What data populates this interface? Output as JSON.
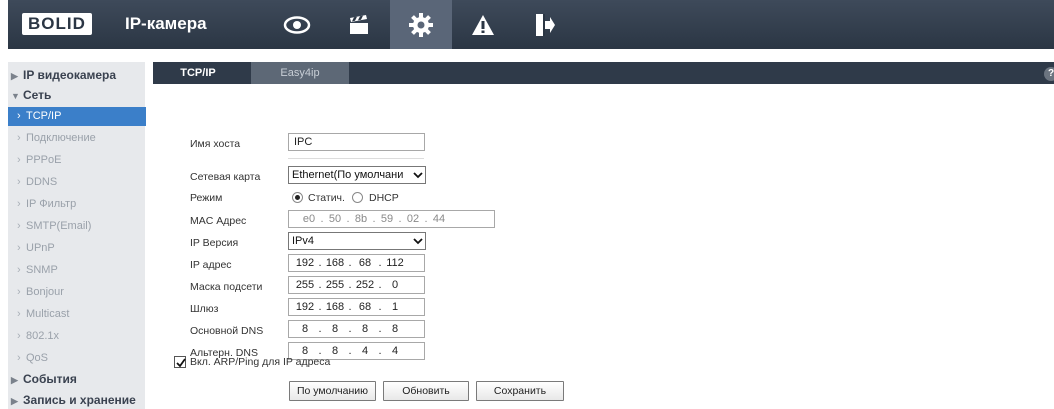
{
  "header": {
    "logo": "BOLID",
    "title": "IP-камера",
    "nav_icons": [
      "eye-icon",
      "clapperboard-icon",
      "gear-icon",
      "warning-icon",
      "exit-icon"
    ],
    "active_nav": "gear-icon"
  },
  "sidebar": {
    "sections": [
      {
        "label": "IP видеокамера",
        "expanded": false
      },
      {
        "label": "Сеть",
        "expanded": true
      },
      {
        "label": "События",
        "expanded": false
      },
      {
        "label": "Запись и хранение",
        "expanded": false
      }
    ],
    "network_items": [
      "TCP/IP",
      "Подключение",
      "PPPoE",
      "DDNS",
      "IP Фильтр",
      "SMTP(Email)",
      "UPnP",
      "SNMP",
      "Bonjour",
      "Multicast",
      "802.1x",
      "QoS"
    ],
    "active_item": "TCP/IP"
  },
  "tabs": {
    "active": "TCP/IP",
    "inactive": "Easy4ip"
  },
  "form": {
    "hostname_label": "Имя хоста",
    "hostname_value": "IPC",
    "nic_label": "Сетевая карта",
    "nic_value": "Ethernet(По умолчани",
    "mode_label": "Режим",
    "mode_static": "Статич.",
    "mode_dhcp": "DHCP",
    "mode_selected": "static",
    "mac_label": "MAC Адрес",
    "mac": [
      "e0",
      "50",
      "8b",
      "59",
      "02",
      "44"
    ],
    "ipver_label": "IP Версия",
    "ipver_value": "IPv4",
    "ip_label": "IP адрес",
    "ip": [
      "192",
      "168",
      "68",
      "112"
    ],
    "mask_label": "Маска подсети",
    "mask": [
      "255",
      "255",
      "252",
      "0"
    ],
    "gateway_label": "Шлюз",
    "gateway": [
      "192",
      "168",
      "68",
      "1"
    ],
    "dns1_label": "Основной DNS",
    "dns1": [
      "8",
      "8",
      "8",
      "8"
    ],
    "dns2_label": "Альтерн. DNS",
    "dns2": [
      "8",
      "8",
      "4",
      "4"
    ],
    "arp_label": "Вкл. ARP/Ping для IP адреса",
    "arp_checked": true
  },
  "buttons": {
    "default": "По умолчанию",
    "refresh": "Обновить",
    "save": "Сохранить"
  },
  "colors": {
    "header_bg": "#2b3644",
    "active_blue": "#3b7fc9",
    "sidebar_bg": "#e7e9ec"
  }
}
